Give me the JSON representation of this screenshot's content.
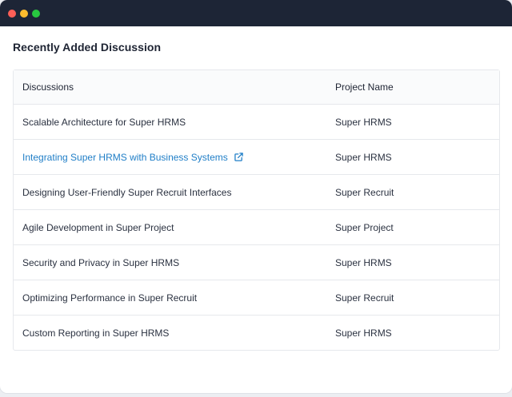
{
  "window": {
    "controls": [
      {
        "name": "close",
        "color": "#ff5f57"
      },
      {
        "name": "minimize",
        "color": "#febc2e"
      },
      {
        "name": "maximize",
        "color": "#28c840"
      }
    ]
  },
  "colors": {
    "titlebar": "#1d2536",
    "link": "#1f7ec7",
    "text": "#2a3140",
    "border": "#e6e8ec"
  },
  "section": {
    "title": "Recently Added Discussion"
  },
  "table": {
    "headers": {
      "discussion": "Discussions",
      "project": "Project Name"
    },
    "rows": [
      {
        "discussion": "Scalable Architecture for Super HRMS",
        "project": "Super HRMS",
        "is_link": false
      },
      {
        "discussion": "Integrating Super HRMS with Business Systems",
        "project": "Super HRMS",
        "is_link": true,
        "icon": "external-link-icon"
      },
      {
        "discussion": "Designing User-Friendly Super Recruit Interfaces",
        "project": "Super Recruit",
        "is_link": false
      },
      {
        "discussion": "Agile Development in Super Project",
        "project": "Super Project",
        "is_link": false
      },
      {
        "discussion": "Security and Privacy in Super HRMS",
        "project": "Super HRMS",
        "is_link": false
      },
      {
        "discussion": "Optimizing Performance in Super Recruit",
        "project": "Super Recruit",
        "is_link": false
      },
      {
        "discussion": "Custom Reporting in Super HRMS",
        "project": "Super HRMS",
        "is_link": false
      }
    ]
  }
}
